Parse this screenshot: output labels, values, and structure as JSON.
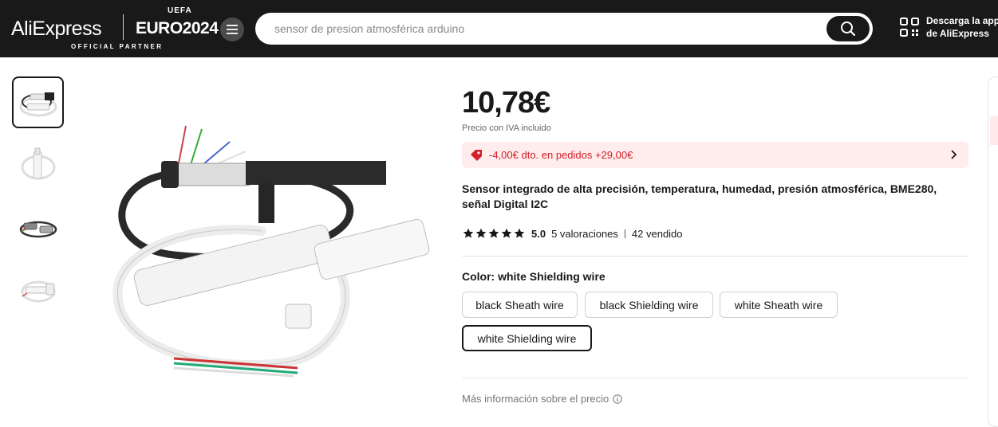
{
  "header": {
    "logo_text": "AliExpress",
    "euro_text": "EURO2024",
    "uefa_text": "UEFA",
    "partner_text": "OFFICIAL PARTNER",
    "search_placeholder": "sensor de presion atmosférica arduino",
    "app_download_line1": "Descarga la app",
    "app_download_line2": "de AliExpress"
  },
  "gallery": {
    "thumbnails": [
      "thumb-1",
      "thumb-2",
      "thumb-3",
      "thumb-4"
    ],
    "selected_index": 0
  },
  "product": {
    "price": "10,78€",
    "price_note": "Precio con IVA incluido",
    "coupon_text": "-4,00€ dto. en pedidos +29,00€",
    "title": "Sensor integrado de alta precisión, temperatura, humedad, presión atmosférica, BME280, señal Digital I2C",
    "rating": {
      "stars": 5,
      "score": "5.0",
      "reviews": "5 valoraciones",
      "sold": "42 vendido"
    },
    "color_label": "Color: white Shielding wire",
    "color_options": [
      "black Sheath wire",
      "black Shielding wire",
      "white Sheath wire",
      "white Shielding wire"
    ],
    "selected_color": "white Shielding wire",
    "more_info": "Más información sobre el precio"
  },
  "colors": {
    "header_bg": "#191919",
    "coupon_bg": "#ffecec",
    "coupon_text": "#d4202a",
    "text_primary": "#191919"
  }
}
